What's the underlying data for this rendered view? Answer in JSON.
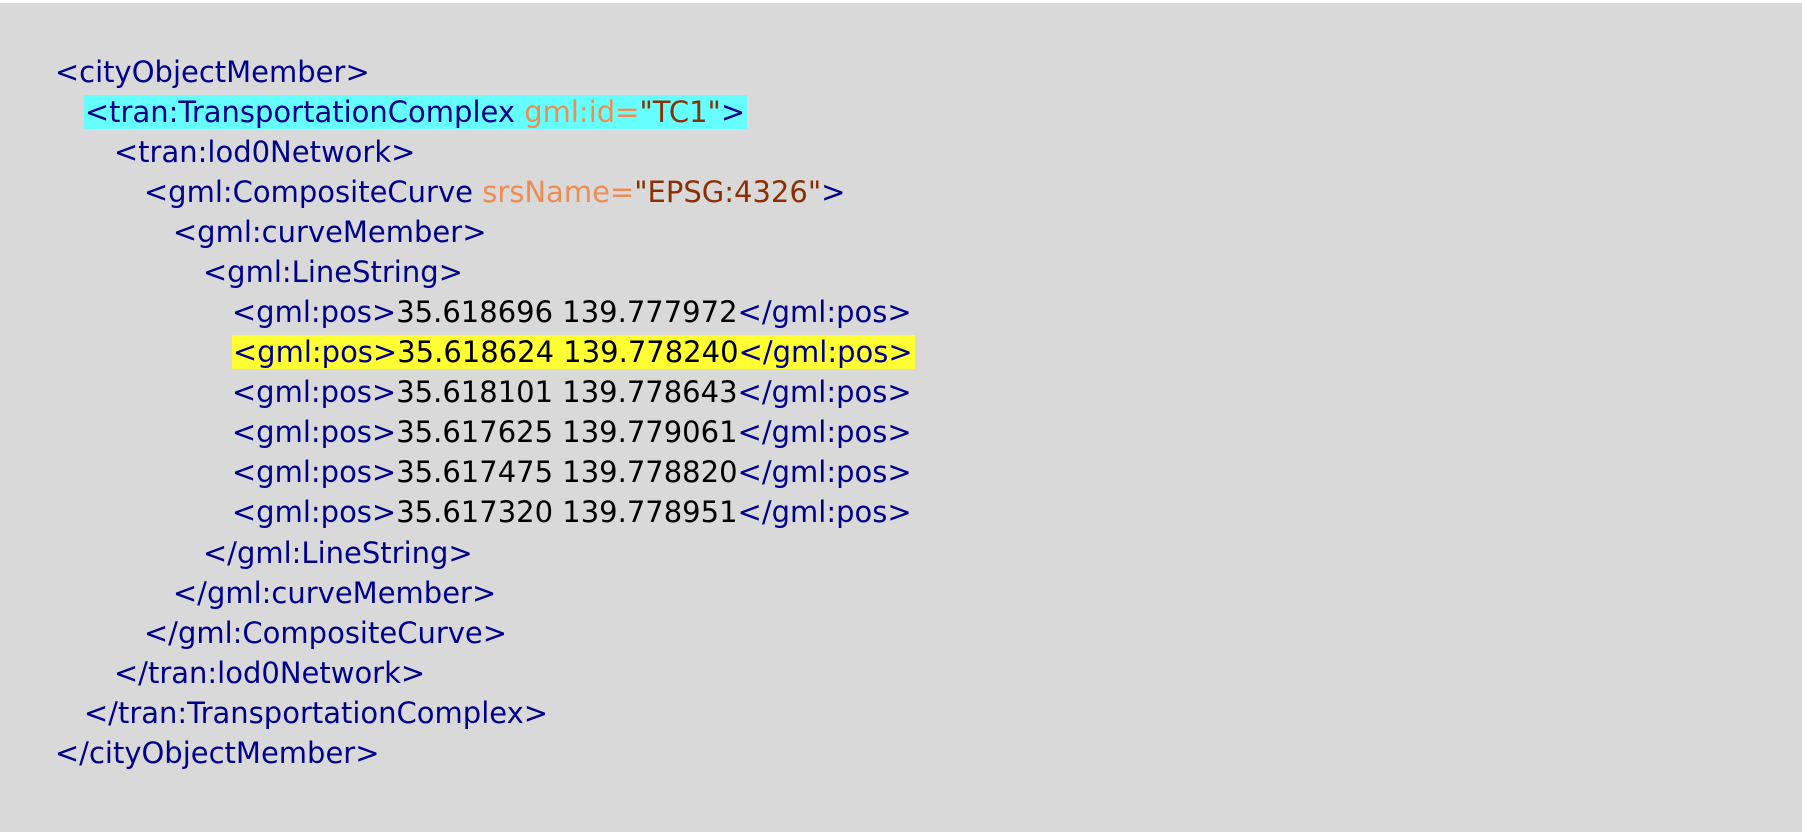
{
  "code": {
    "lines": [
      {
        "tag_open": "<cityObjectMember>"
      },
      {
        "tag_open": "<tran:TransportationComplex ",
        "attr_name": "gml:id=",
        "attr_value": "\"TC1\"",
        "tag_close": ">"
      },
      {
        "tag_open": "<tran:lod0Network>"
      },
      {
        "tag_open": "<gml:CompositeCurve ",
        "attr_name": "srsName=",
        "attr_value": "\"EPSG:4326\"",
        "tag_close": ">"
      },
      {
        "tag_open": "<gml:curveMember>"
      },
      {
        "tag_open": "<gml:LineString>"
      },
      {
        "tag_open": "<gml:pos>",
        "text": "35.618696 139.777972",
        "tag_close": "</gml:pos>"
      },
      {
        "tag_open": "<gml:pos>",
        "text": "35.618624 139.778240",
        "tag_close": "</gml:pos>"
      },
      {
        "tag_open": "<gml:pos>",
        "text": "35.618101 139.778643",
        "tag_close": "</gml:pos>"
      },
      {
        "tag_open": "<gml:pos>",
        "text": "35.617625 139.779061",
        "tag_close": "</gml:pos>"
      },
      {
        "tag_open": "<gml:pos>",
        "text": "35.617475 139.778820",
        "tag_close": "</gml:pos>"
      },
      {
        "tag_open": "<gml:pos>",
        "text": "35.617320 139.778951",
        "tag_close": "</gml:pos>"
      },
      {
        "tag_open": "</gml:LineString>"
      },
      {
        "tag_open": "</gml:curveMember>"
      },
      {
        "tag_open": "</gml:CompositeCurve>"
      },
      {
        "tag_open": "</tran:lod0Network>"
      },
      {
        "tag_open": "</tran:TransportationComplex>"
      },
      {
        "tag_open": "</cityObjectMember>"
      }
    ]
  },
  "colors": {
    "background": "#d9d9d9",
    "tag": "#00008b",
    "attribute_name": "#ef8c52",
    "attribute_value": "#8b2f05",
    "text_content": "#000000",
    "highlight_cyan": "#66ffff",
    "highlight_yellow": "#ffff33"
  }
}
